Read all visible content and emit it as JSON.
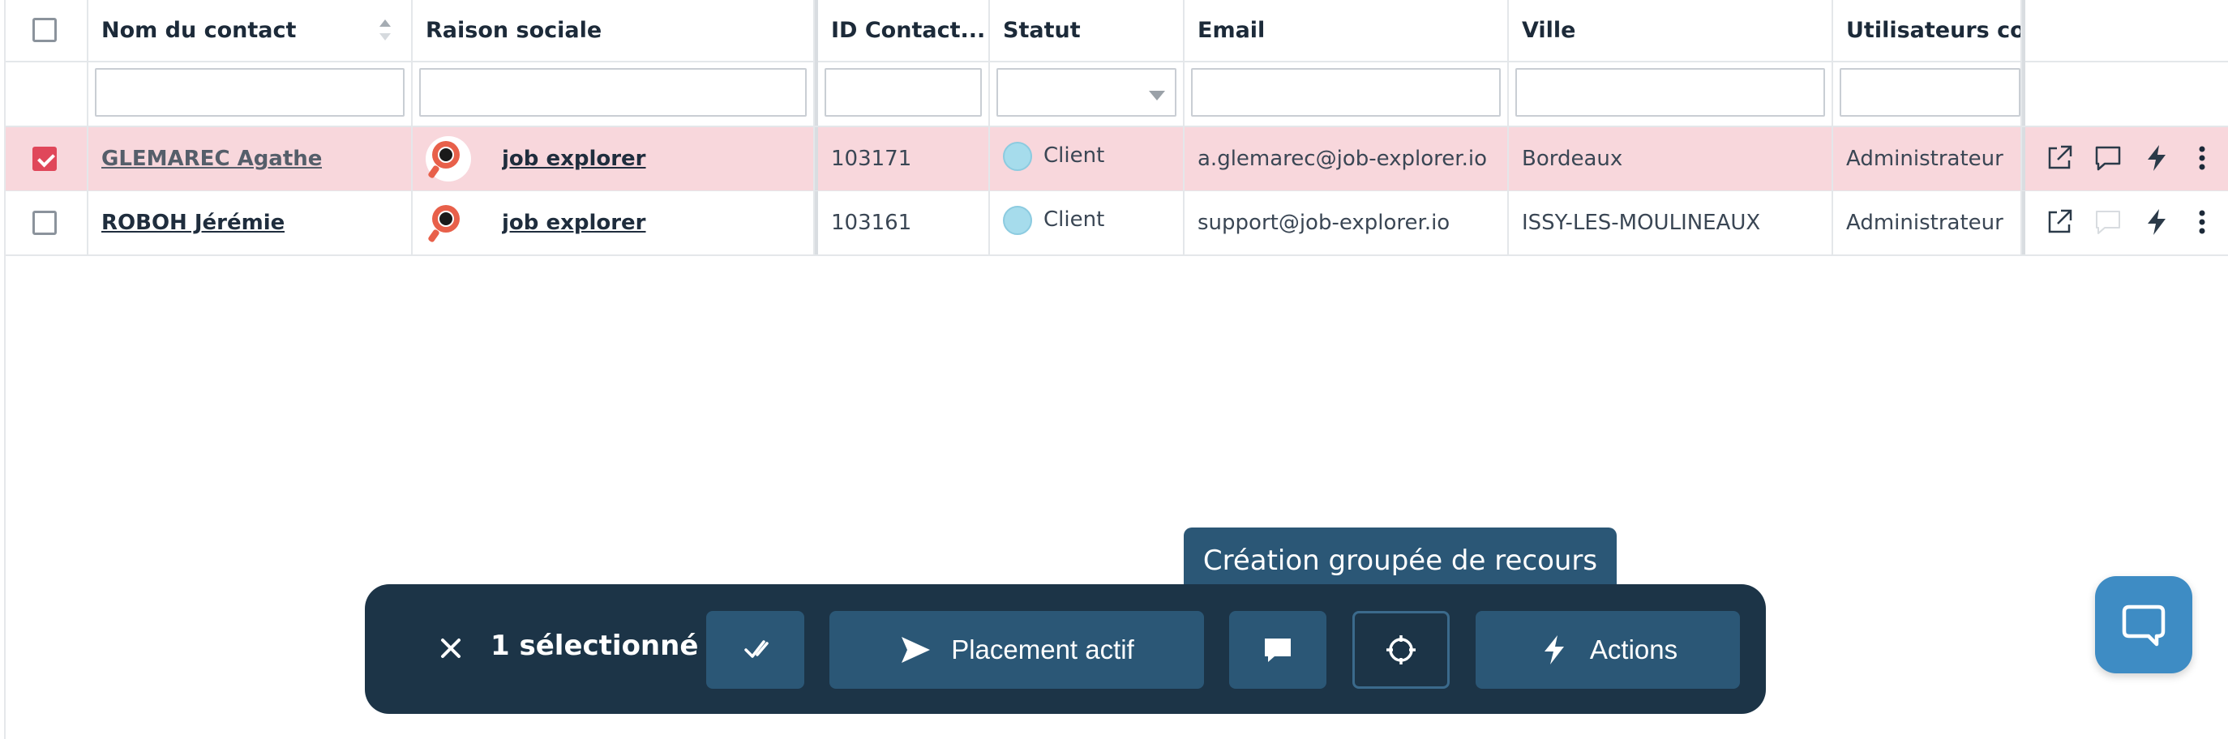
{
  "columns": {
    "select": "",
    "contact": "Nom du contact",
    "company": "Raison sociale",
    "id": "ID Contact...",
    "status": "Statut",
    "email": "Email",
    "city": "Ville",
    "users": "Utilisateurs con"
  },
  "rows": [
    {
      "selected": true,
      "contact": "GLEMAREC Agathe",
      "company": "job explorer",
      "id": "103171",
      "status": "Client",
      "email": "a.glemarec@job-explorer.io",
      "city": "Bordeaux",
      "users": "Administrateur"
    },
    {
      "selected": false,
      "contact": "ROBOH Jérémie",
      "company": "job explorer",
      "id": "103161",
      "status": "Client",
      "email": "support@job-explorer.io",
      "city": "ISSY-LES-MOULINEAUX",
      "users": "Administrateur"
    }
  ],
  "action_bar": {
    "selected_label": "1 sélectionné",
    "placement_label": "Placement actif",
    "actions_label": "Actions"
  },
  "tooltip": "Création groupée de recours",
  "colors": {
    "selected_row": "#f8d7dc",
    "checkbox_checked": "#e0475a",
    "bar_bg": "#1c3447",
    "bar_button": "#2b5776",
    "status_client": "#a6dcec",
    "chat_fab": "#3e8cc4"
  },
  "icons": [
    "close-icon",
    "double-check-icon",
    "send-icon",
    "comment-icon",
    "target-icon",
    "bolt-icon",
    "external-link-icon",
    "more-vertical-icon",
    "chat-bubble-icon",
    "sort-icon"
  ]
}
